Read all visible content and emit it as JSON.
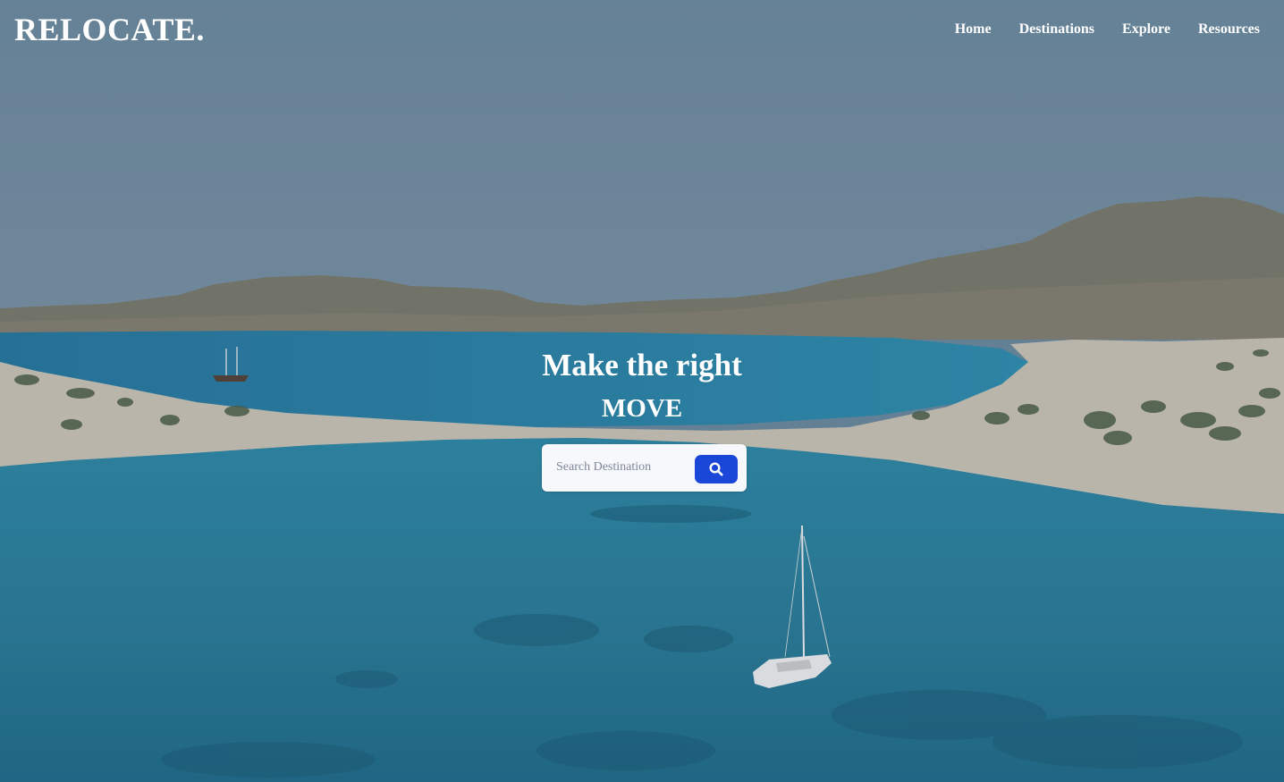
{
  "header": {
    "logo": "RELOCATE.",
    "nav": [
      {
        "label": "Home"
      },
      {
        "label": "Destinations"
      },
      {
        "label": "Explore"
      },
      {
        "label": "Resources"
      }
    ]
  },
  "hero": {
    "title": "Make the right",
    "subtitle": "MOVE",
    "search": {
      "placeholder": "Search Destination",
      "button_icon": "search-icon",
      "button_color": "#1b47d8"
    }
  },
  "background": {
    "description_icon": "beach-landscape-image"
  }
}
